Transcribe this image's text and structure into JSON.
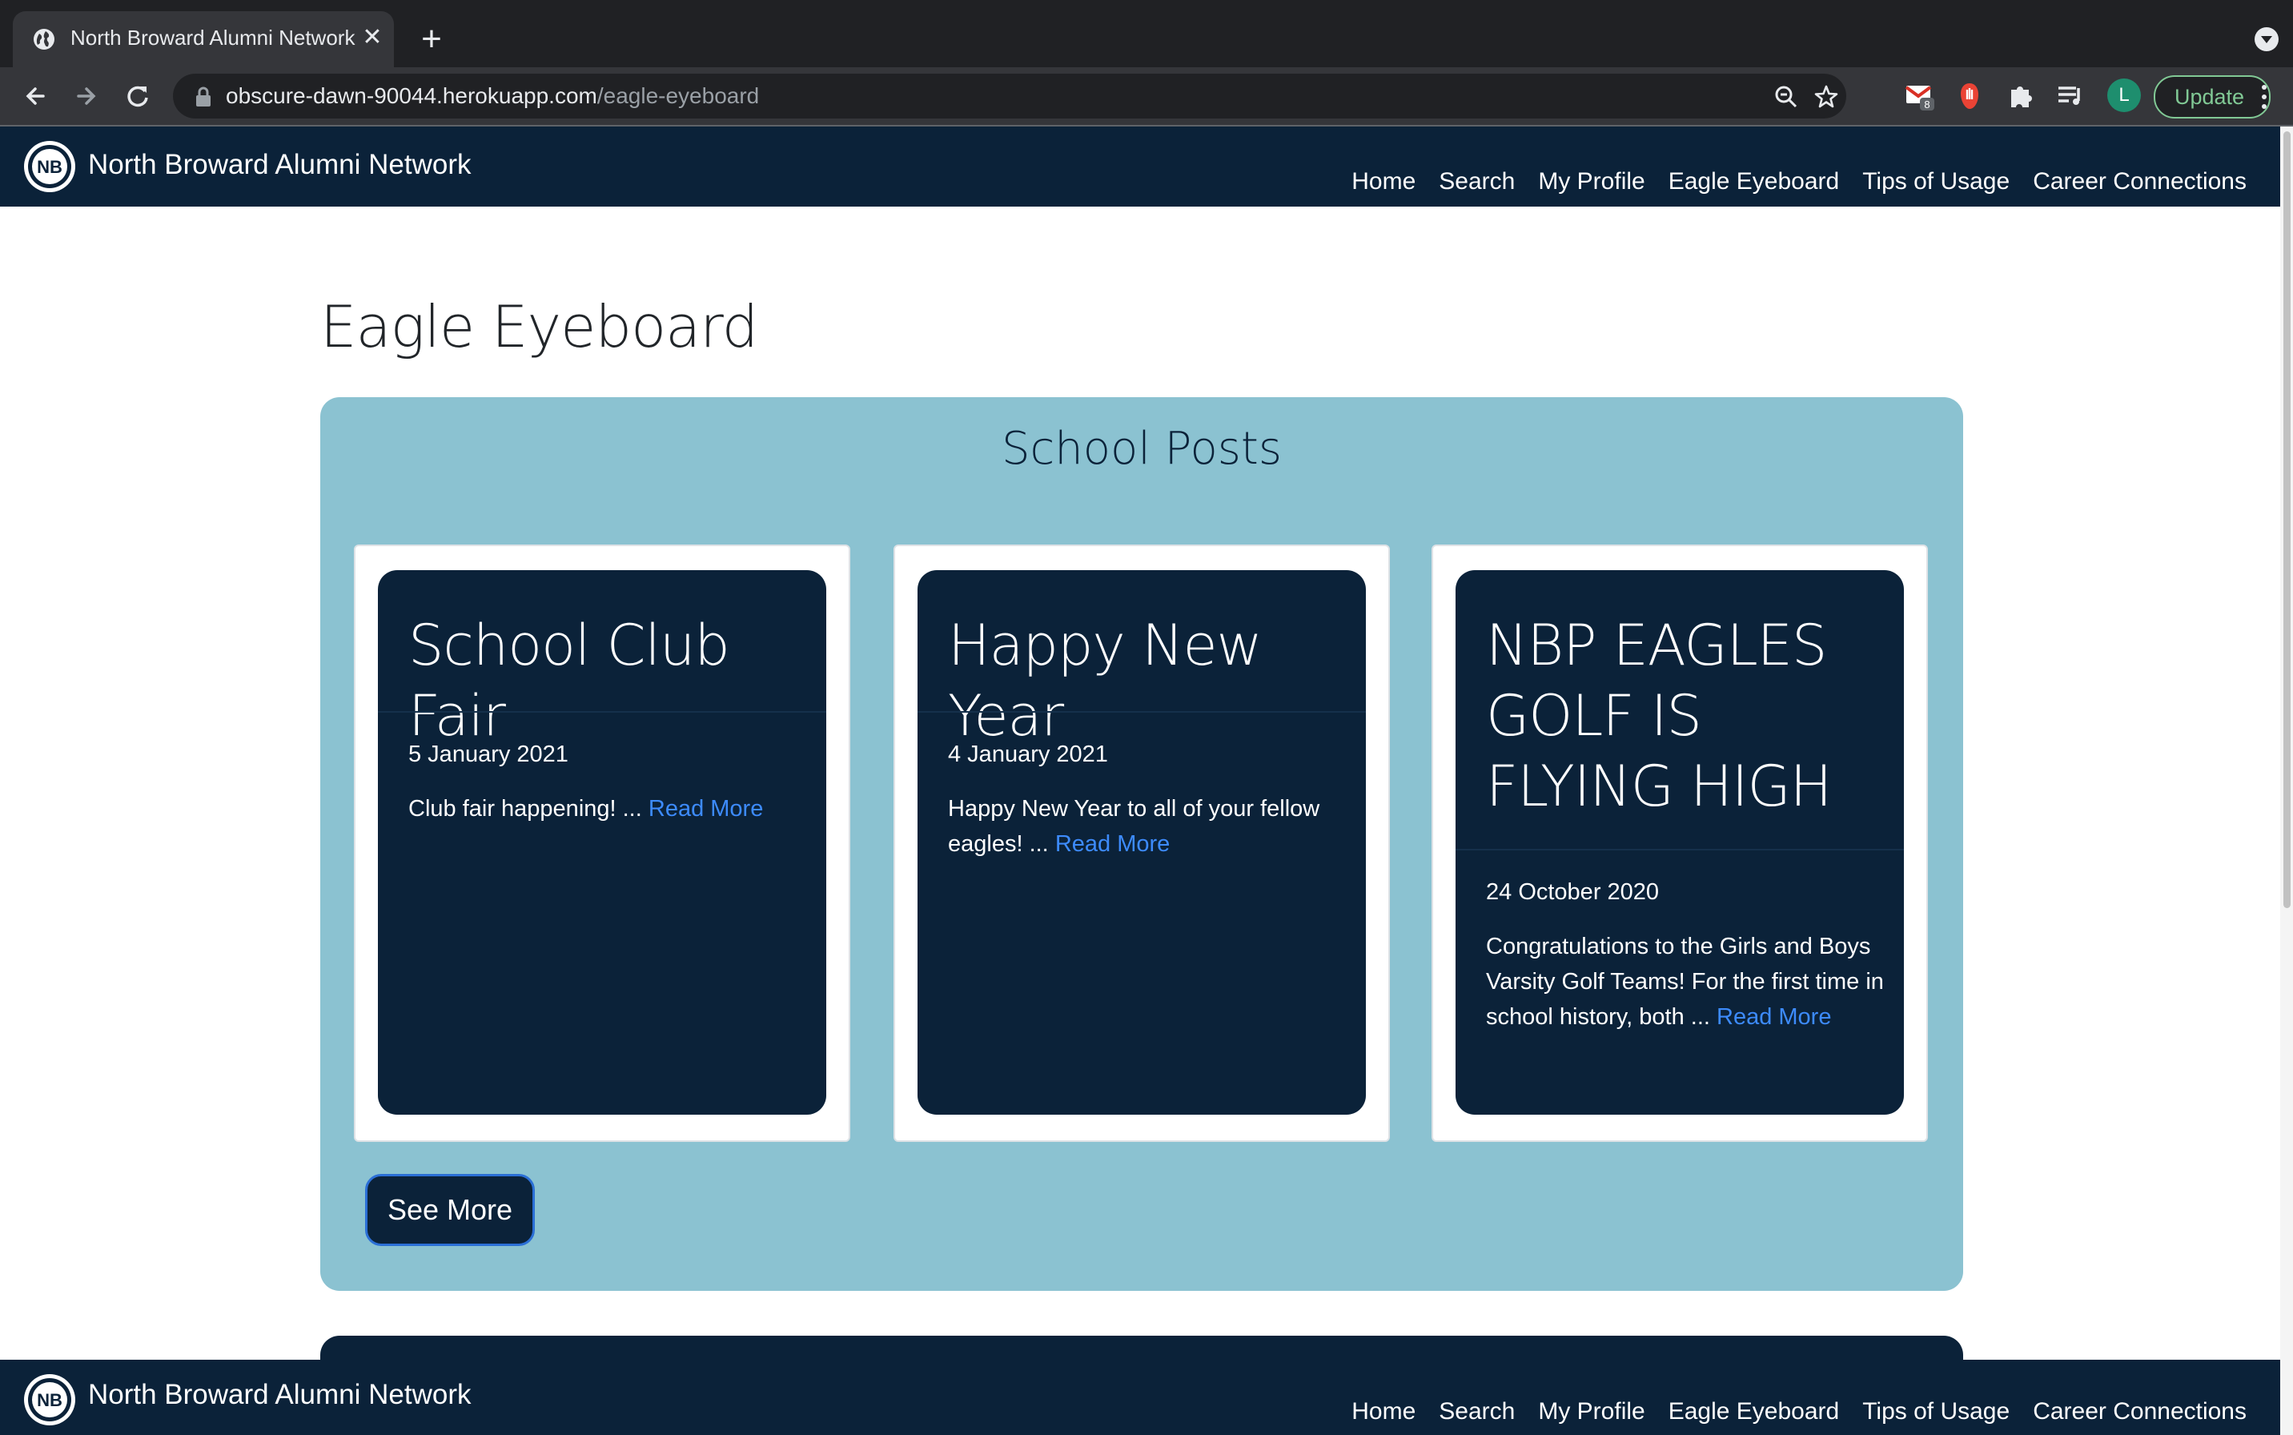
{
  "browser": {
    "tab_title": "North Broward Alumni Network",
    "url_host": "obscure-dawn-90044.herokuapp.com",
    "url_path": "/eagle-eyeboard",
    "mail_badge": "8",
    "avatar_letter": "L",
    "update_label": "Update"
  },
  "navbar": {
    "logo_text": "NB",
    "brand": "North Broward Alumni Network",
    "links": [
      "Home",
      "Search",
      "My Profile",
      "Eagle Eyeboard",
      "Tips of Usage",
      "Career Connections"
    ]
  },
  "page": {
    "title": "Eagle Eyeboard",
    "section_title": "School Posts",
    "read_more": "Read More",
    "see_more": "See More"
  },
  "posts": [
    {
      "title": "School Club Fair",
      "date": "5 January 2021",
      "excerpt": "Club fair happening! ..."
    },
    {
      "title": "Happy New Year",
      "date": "4 January 2021",
      "excerpt": "Happy New Year to all of your fellow eagles! ..."
    },
    {
      "title": "NBP EAGLES GOLF IS FLYING HIGH",
      "date": "24 October 2020",
      "excerpt": "Congratulations to the Girls and Boys Varsity Golf Teams! For the first time in school history, both ..."
    }
  ],
  "colors": {
    "navbar_bg": "#0b2239",
    "panel_bg": "#8bc2d1",
    "link": "#3d8bfd"
  },
  "icons": {
    "tab": "globe-icon",
    "close": "close-icon",
    "new_tab": "plus-icon",
    "back": "back-arrow-icon",
    "forward": "forward-arrow-icon",
    "reload": "reload-icon",
    "lock": "lock-icon",
    "zoom": "zoom-out-icon",
    "bookmark": "star-icon",
    "gmail": "gmail-icon",
    "stop": "hand-stop-icon",
    "extensions": "puzzle-icon",
    "media": "media-queue-icon",
    "menu": "kebab-menu-icon"
  }
}
